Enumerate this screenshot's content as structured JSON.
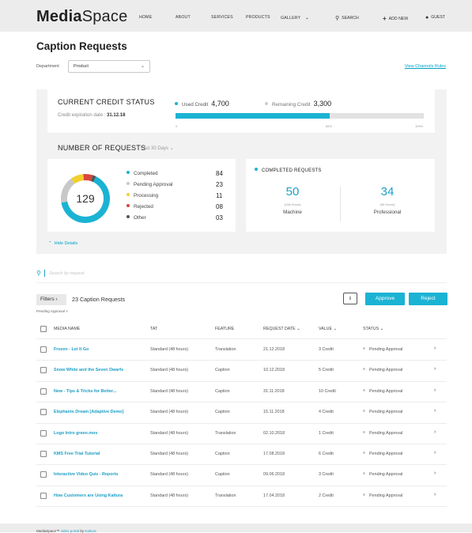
{
  "header": {
    "logo_bold": "Media",
    "logo_rest": "Space",
    "nav": [
      "HOME",
      "ABOUT",
      "SERVICES",
      "PRODUCTS",
      "GALLERY"
    ],
    "search_label": "SEARCH",
    "add_new_label": "ADD NEW",
    "guest_label": "GUEST"
  },
  "page_title": "Caption Requests",
  "department": {
    "label": "Department",
    "selected": "Product"
  },
  "channels_link": "View Channels Rules",
  "credit": {
    "title": "CURRENT CREDIT STATUS",
    "expiration_label": "Credit expiration date :",
    "expiration_date": "31.12.18",
    "used_label": "Used Credit",
    "used_value": "4,700",
    "remaining_label": "Remaining Credit",
    "remaining_value": "3,300",
    "used_fraction": 0.62,
    "ticks": [
      "0",
      "66%",
      "100%"
    ],
    "used_color": "#1bb3d3",
    "remaining_color": "#e2e2e2"
  },
  "requests": {
    "title": "NUMBER OF REQUESTS",
    "range": "Last 30 Days",
    "total": "129",
    "statuses": [
      {
        "label": "Completed",
        "value": "84",
        "color": "#1bb3d3"
      },
      {
        "label": "Pending Approval",
        "value": "23",
        "color": "#c8c8c8"
      },
      {
        "label": "Processing",
        "value": "11",
        "color": "#f2cf2d"
      },
      {
        "label": "Rejected",
        "value": "08",
        "color": "#d9473d"
      },
      {
        "label": "Other",
        "value": "03",
        "color": "#555555"
      }
    ],
    "completed": {
      "title": "COMPLETED REQUESTS",
      "machine_value": "50",
      "machine_hours": "(158 Hours)",
      "machine_label": "Machine",
      "professional_value": "34",
      "professional_hours": "(96 Hours)",
      "professional_label": "Professional"
    },
    "hide_details": "Hide Details"
  },
  "search": {
    "placeholder": "Search by request"
  },
  "list": {
    "filters_label": "Filters",
    "count_text": "23 Caption Requests",
    "active_filter": "Pending Approval",
    "approve_label": "Approve",
    "reject_label": "Reject",
    "columns": [
      "MEDIA NAME",
      "TAT",
      "FEATURE",
      "REQUEST DATE",
      "VALUE",
      "STATUS"
    ],
    "rows": [
      {
        "name": "Frozen - Let It Go",
        "tat": "Standard (48 hours)",
        "feature": "Translation",
        "date": "21.12.2018",
        "value": "3 Credit",
        "status": "Pending Approval"
      },
      {
        "name": "Snow White and the Seven Dwarfs",
        "tat": "Standard (48 hours)",
        "feature": "Caption",
        "date": "10.12.2018",
        "value": "5 Credit",
        "status": "Pending Approval"
      },
      {
        "name": "New - Tips & Tricks for Better...",
        "tat": "Standard (48 hours)",
        "feature": "Caption",
        "date": "31.11.2018",
        "value": "10 Credit",
        "status": "Pending Approval"
      },
      {
        "name": "Elephants Dream [Adaptive Demo]",
        "tat": "Standard (48 hours)",
        "feature": "Caption",
        "date": "15.11.2018",
        "value": "4 Credit",
        "status": "Pending Approval"
      },
      {
        "name": "Logo Intro green.mov",
        "tat": "Standard (48 hours)",
        "feature": "Translation",
        "date": "02.10.2018",
        "value": "1 Credit",
        "status": "Pending Approval"
      },
      {
        "name": "KMS Free Trial Tutorial",
        "tat": "Standard (48 hours)",
        "feature": "Caption",
        "date": "17.08.2018",
        "value": "6 Credit",
        "status": "Pending Approval"
      },
      {
        "name": "Interactive Video Quiz - Reports",
        "tat": "Standard (48 hours)",
        "feature": "Caption",
        "date": "09.06.2018",
        "value": "3 Credit",
        "status": "Pending Approval"
      },
      {
        "name": "How Customers are Using Kaltura",
        "tat": "Standard (48 hours)",
        "feature": "Translation",
        "date": "17.04.2018",
        "value": "2 Credit",
        "status": "Pending Approval"
      }
    ]
  },
  "footer": {
    "prefix": "MediaSpace™",
    "link1": "video portal",
    "middle": "by",
    "link2": "Kaltura"
  }
}
